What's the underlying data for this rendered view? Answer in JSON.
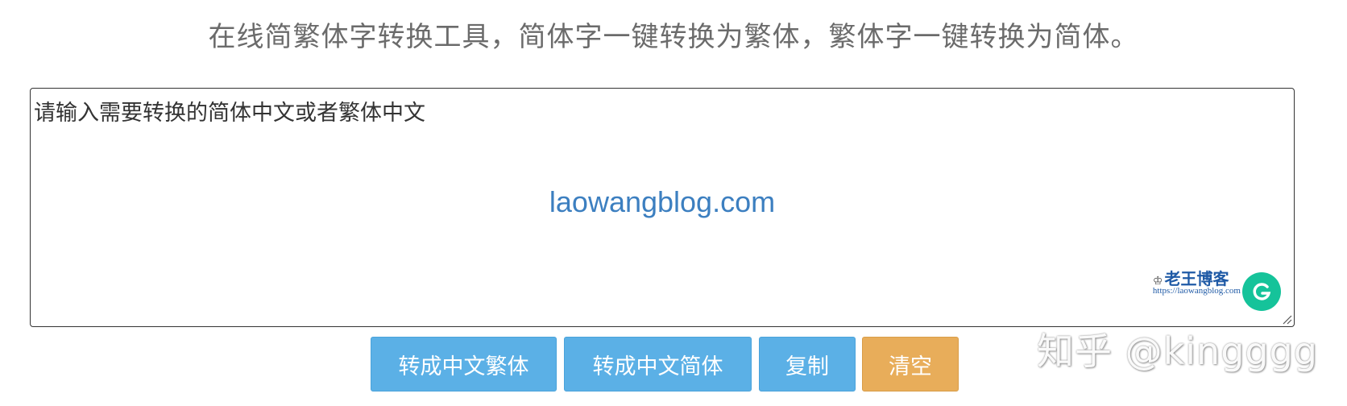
{
  "header": {
    "title": "在线简繁体字转换工具，简体字一键转换为繁体，繁体字一键转换为简体。"
  },
  "editor": {
    "placeholder": "请输入需要转换的简体中文或者繁体中文",
    "watermark_center": "laowangblog.com",
    "watermark_logo_title": "老王博客",
    "watermark_logo_url": "https://laowangblog.com",
    "grammarly_icon": "grammarly-icon"
  },
  "actions": {
    "to_traditional": "转成中文繁体",
    "to_simplified": "转成中文简体",
    "copy": "复制",
    "clear": "清空"
  },
  "overlay": {
    "zhihu_watermark": "知乎 @kingggg"
  },
  "colors": {
    "primary_button": "#5bb0e6",
    "clear_button": "#e8ad5a",
    "title_text": "#6b6b6b",
    "watermark_blue": "#3c7fc0"
  }
}
